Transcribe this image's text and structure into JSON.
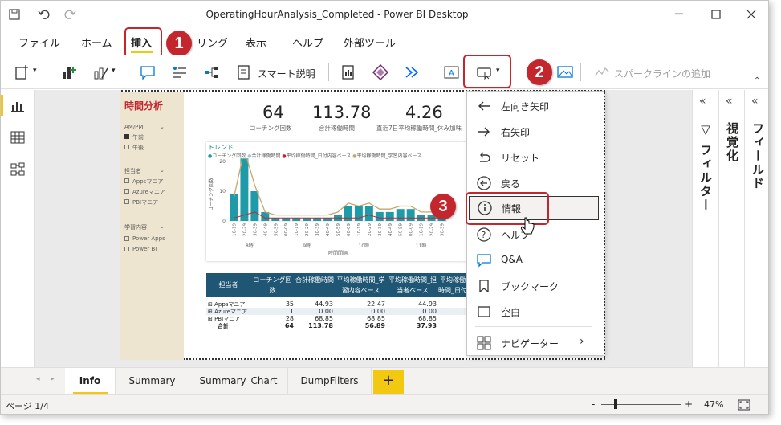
{
  "window": {
    "title": "OperatingHourAnalysis_Completed - Power BI Desktop"
  },
  "menu": {
    "items": [
      "ファイル",
      "ホーム",
      "挿入",
      "リング",
      "表示",
      "ヘルプ",
      "外部ツール"
    ]
  },
  "ribbon": {
    "smart_narrative": "スマート説明",
    "sparkline": "スパークラインの追加"
  },
  "badges": [
    "1",
    "2",
    "3"
  ],
  "report": {
    "title": "時間分析",
    "slicers": [
      {
        "label": "AM/PM",
        "items": [
          "午前",
          "午後"
        ]
      },
      {
        "label": "担当者",
        "items": [
          "Appsマニア",
          "Azureマニア",
          "PBIマニア"
        ]
      },
      {
        "label": "学習内容",
        "items": [
          "Power Apps",
          "Power BI"
        ]
      }
    ],
    "kpis": [
      {
        "value": "64",
        "label": "コーチング回数"
      },
      {
        "value": "113.78",
        "label": "合計稼働時間"
      },
      {
        "value": "4.26",
        "label": "直近7日平均稼働時間_休み加味"
      }
    ],
    "chart_title": "トレンド",
    "chart_legend": [
      "コーチング回数",
      "合計稼働時間",
      "平均稼働時間_日付内容ベース",
      "平均稼働時間_学習内容ベース"
    ],
    "chart_xlabel": "時間間隔",
    "chart_ylabel": "コーチング回数",
    "hour_groups": [
      "8時",
      "9時",
      "10時",
      "11時"
    ],
    "table": {
      "headers": [
        "担当者",
        "コーチング回数",
        "合計稼働時間",
        "平均稼働時間_学習内容ベース",
        "平均稼働時間_担当者ベース",
        "平均稼働時間_日付内容ベース"
      ],
      "rows": [
        {
          "name": "Appsマニア",
          "c1": "35",
          "c2": "44.93",
          "c3": "22.47",
          "c4": "44.93"
        },
        {
          "name": "Azureマニア",
          "c1": "1",
          "c2": "0.00",
          "c3": "0.00",
          "c4": "0.00"
        },
        {
          "name": "PBIマニア",
          "c1": "28",
          "c2": "68.85",
          "c3": "68.85",
          "c4": "68.85"
        },
        {
          "name": "合計",
          "c1": "64",
          "c2": "113.78",
          "c3": "56.89",
          "c4": "37.93"
        }
      ]
    }
  },
  "chart_data": {
    "type": "bar",
    "title": "トレンド",
    "xlabel": "時間間隔",
    "ylabel": "コーチング回数",
    "categories": [
      "10-19",
      "20-29",
      "30-39",
      "40-49",
      "50-59",
      "00-09",
      "10-19",
      "20-29",
      "30-39",
      "40-49",
      "50-59",
      "00-09",
      "10-19",
      "20-29",
      "30-39",
      "40-49",
      "50-59",
      "00-09",
      "10-19",
      "20-29",
      "30-39"
    ],
    "series": [
      {
        "name": "コーチング回数",
        "values": [
          9,
          21,
          10,
          3,
          1,
          1,
          1,
          1,
          1,
          1,
          2,
          5,
          5,
          5,
          3,
          3,
          4,
          4,
          2,
          2,
          4
        ]
      },
      {
        "name": "平均稼働時間_日付内容ベース",
        "values": [
          1,
          2,
          3,
          1,
          1,
          1,
          1,
          1,
          1,
          1,
          1,
          1,
          1,
          2,
          1,
          1,
          1,
          1,
          1,
          1,
          1
        ]
      },
      {
        "name": "平均稼働時間_学習内容ベース",
        "values": [
          8,
          24,
          12,
          3,
          2,
          2,
          2,
          2,
          2,
          2,
          3,
          6,
          5,
          6,
          4,
          4,
          5,
          5,
          3,
          3,
          5
        ]
      }
    ],
    "ylim": [
      0,
      20
    ]
  },
  "dropdown": {
    "items": [
      "左向き矢印",
      "右矢印",
      "リセット",
      "戻る",
      "情報",
      "ヘルプ",
      "Q&A",
      "ブックマーク",
      "空白",
      "ナビゲーター"
    ]
  },
  "panes": {
    "filters": "フィルター",
    "visualizations": "視覚化",
    "fields": "フィールド"
  },
  "tabs": [
    "Info",
    "Summary",
    "Summary_Chart",
    "DumpFilters"
  ],
  "status": {
    "page": "ページ 1/4",
    "zoom": "47%"
  }
}
